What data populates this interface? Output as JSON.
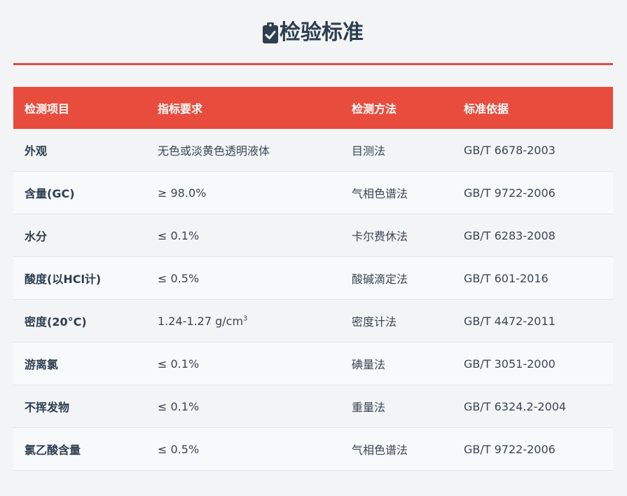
{
  "page": {
    "title": "检验标准",
    "title_icon": "clipboard-check-icon",
    "accent_color": "#e84c3d",
    "text_color": "#2c3e50"
  },
  "table": {
    "headers": [
      "检测项目",
      "指标要求",
      "检测方法",
      "标准依据"
    ],
    "rows": [
      {
        "item": "外观",
        "requirement": "无色或淡黄色透明液体",
        "method": "目测法",
        "standard": "GB/T 6678-2003"
      },
      {
        "item": "含量(GC)",
        "requirement": "≥ 98.0%",
        "method": "气相色谱法",
        "standard": "GB/T 9722-2006"
      },
      {
        "item": "水分",
        "requirement": "≤ 0.1%",
        "method": "卡尔费休法",
        "standard": "GB/T 6283-2008"
      },
      {
        "item": "酸度(以HCl计)",
        "requirement": "≤ 0.5%",
        "method": "酸碱滴定法",
        "standard": "GB/T 601-2016"
      },
      {
        "item": "密度(20°C)",
        "requirement": "1.24-1.27 g/cm",
        "requirement_sup": "3",
        "method": "密度计法",
        "standard": "GB/T 4472-2011"
      },
      {
        "item": "游离氯",
        "requirement": "≤ 0.1%",
        "method": "碘量法",
        "standard": "GB/T 3051-2000"
      },
      {
        "item": "不挥发物",
        "requirement": "≤ 0.1%",
        "method": "重量法",
        "standard": "GB/T 6324.2-2004"
      },
      {
        "item": "氯乙酸含量",
        "requirement": "≤ 0.5%",
        "method": "气相色谱法",
        "standard": "GB/T 9722-2006"
      }
    ]
  }
}
